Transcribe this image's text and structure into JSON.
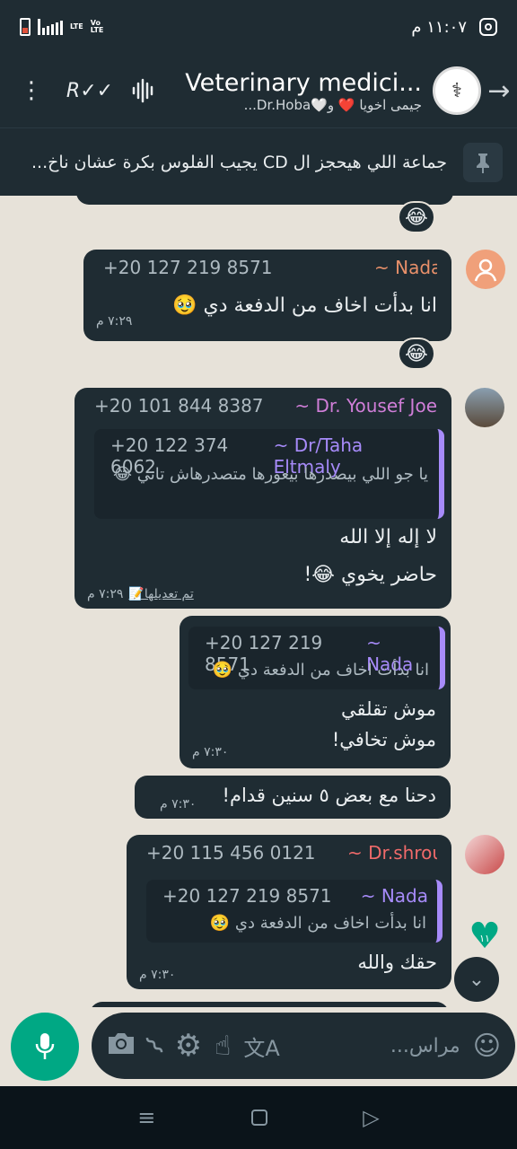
{
  "status": {
    "time": "١١:٠٧ م",
    "network": "LTE",
    "volte": "Vo LTE"
  },
  "header": {
    "title": "Veterinary medici...",
    "subtitle": "جيمى اخويا ❤️ و🤍Dr.Hoba..."
  },
  "pinned": {
    "text": "جماعة اللي هيحجز ال CD يجيب الفلوس بكرة عشان ناخ..."
  },
  "messages": [
    {
      "reaction": "😂"
    },
    {
      "sender": "~ Nada",
      "phone": "+20 127 219 8571",
      "text": "انا بدأت اخاف من الدفعة دي 🥹",
      "time": "٧:٢٩ م",
      "reaction": "😂"
    },
    {
      "sender": "~ Dr. Yousef Joe",
      "phone": "+20 101 844 8387",
      "quote_sender": "~ Dr/Taha Eltmaly",
      "quote_phone": "+20 122 374 6062",
      "quote_text": "يا جو اللي بيصدرها بيعورها متصدرهاش تاني 😂",
      "line1": "لا إله إلا الله",
      "line2": "حاضر يخوي 😂!",
      "edited": "تم تعديلها📝",
      "time": "٧:٢٩ م"
    },
    {
      "quote_sender": "~ Nada",
      "quote_phone": "+20 127 219 8571",
      "quote_text": "انا بدأت اخاف من الدفعة دي 🥹",
      "line1": "موش تقلقي",
      "line2": "موش تخافي!",
      "time": "٧:٣٠ م"
    },
    {
      "text": "دحنا مع بعض ٥ سنين قدام!",
      "time": "٧:٣٠ م"
    },
    {
      "sender": "~ Dr.shrouk",
      "phone": "+20 115 456 0121",
      "quote_sender": "~ Nada",
      "quote_phone": "+20 127 219 8571",
      "quote_text": "انا بدأت اخاف من الدفعة دي 🥹",
      "text": "حقك والله",
      "time": "٧:٣٠ م"
    }
  ],
  "unread_count": "١١",
  "input": {
    "placeholder": "مراس..."
  },
  "colors": {
    "accent": "#00a884",
    "bubble": "#1f2c33",
    "background": "#e7e2d9",
    "nada": "#e8906a",
    "yousef": "#d07ed8",
    "shrouk": "#f06a6a",
    "quote_name": "#a78bfa"
  }
}
